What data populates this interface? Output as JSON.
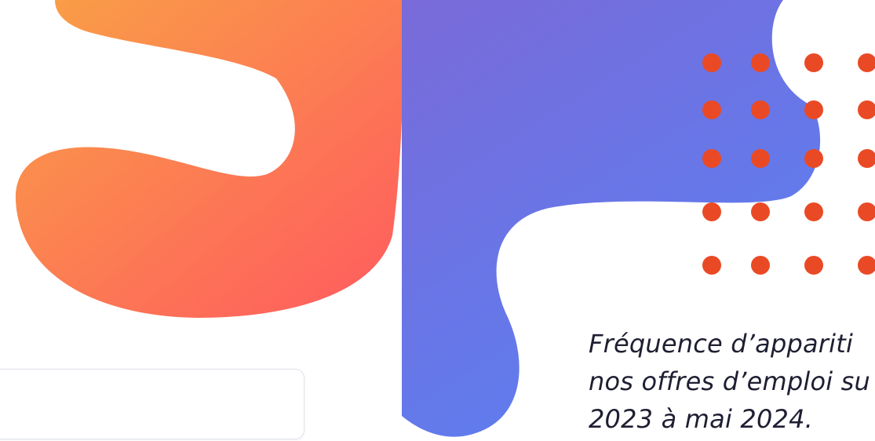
{
  "colors": {
    "orange_start": "#f9a046",
    "orange_end": "#ff5a5f",
    "purple_start": "#7a6ad9",
    "blue_end": "#5b7ff1",
    "dots": "#e94a25",
    "caption_text": "#1f1f33"
  },
  "caption": {
    "line1": "Fréquence d’appariti",
    "line2": "nos offres d’emploi su",
    "line3": "2023 à mai 2024."
  },
  "icons": {
    "dot_grid": "dot-grid-icon"
  }
}
